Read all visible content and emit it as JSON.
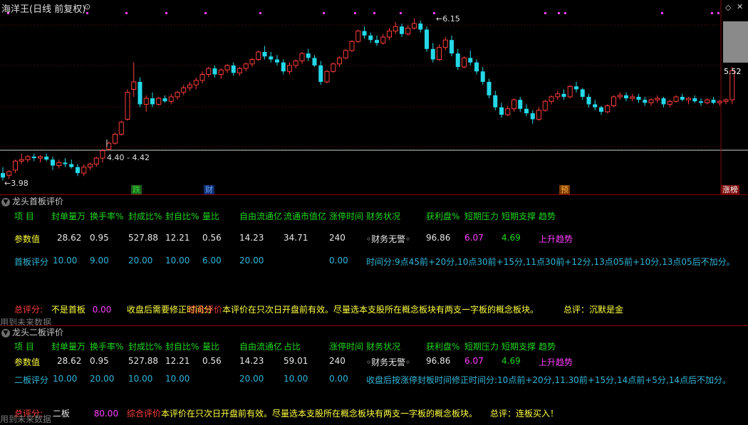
{
  "chart": {
    "title": "海洋王(日线 前复权)",
    "high_label": "6.15",
    "low_label": "3.98",
    "ref_label": "4.40 - 4.42",
    "price_tag": "5.52",
    "markers": [
      {
        "label": "跌",
        "bg": "#1f5f1f",
        "color": "#2fe02f"
      },
      {
        "label": "财",
        "bg": "#0f2f6f",
        "color": "#6fa8ff"
      },
      {
        "label": "预",
        "bg": "#7a3a00",
        "color": "#ffb040"
      },
      {
        "label": "涨榜",
        "bg": "#7a0a0a",
        "color": "#ffffff"
      }
    ],
    "candles": [
      [
        4.08,
        4.16,
        3.98,
        4.02
      ],
      [
        4.05,
        4.12,
        4.0,
        4.1
      ],
      [
        4.12,
        4.26,
        4.08,
        4.24
      ],
      [
        4.24,
        4.34,
        4.2,
        4.26
      ],
      [
        4.26,
        4.32,
        4.22,
        4.3
      ],
      [
        4.3,
        4.34,
        4.24,
        4.28
      ],
      [
        4.28,
        4.32,
        4.22,
        4.3
      ],
      [
        4.3,
        4.34,
        4.24,
        4.26
      ],
      [
        4.26,
        4.3,
        4.12,
        4.18
      ],
      [
        4.18,
        4.26,
        4.14,
        4.22
      ],
      [
        4.22,
        4.28,
        4.16,
        4.2
      ],
      [
        4.2,
        4.26,
        4.14,
        4.16
      ],
      [
        4.16,
        4.2,
        4.04,
        4.08
      ],
      [
        4.08,
        4.2,
        4.04,
        4.16
      ],
      [
        4.16,
        4.22,
        4.12,
        4.2
      ],
      [
        4.2,
        4.3,
        4.16,
        4.28
      ],
      [
        4.28,
        4.4,
        4.22,
        4.38
      ],
      [
        4.4,
        4.5,
        4.38,
        4.48
      ],
      [
        4.48,
        4.62,
        4.46,
        4.6
      ],
      [
        4.6,
        4.78,
        4.58,
        4.76
      ],
      [
        4.8,
        5.2,
        4.78,
        5.16
      ],
      [
        5.2,
        5.56,
        5.1,
        5.3
      ],
      [
        5.3,
        5.36,
        4.96,
        5.0
      ],
      [
        5.0,
        5.12,
        4.9,
        5.08
      ],
      [
        5.08,
        5.16,
        4.96,
        5.0
      ],
      [
        5.0,
        5.1,
        4.98,
        5.08
      ],
      [
        5.08,
        5.12,
        5.02,
        5.04
      ],
      [
        5.04,
        5.14,
        5.0,
        5.1
      ],
      [
        5.1,
        5.18,
        5.06,
        5.16
      ],
      [
        5.16,
        5.26,
        5.12,
        5.22
      ],
      [
        5.22,
        5.3,
        5.18,
        5.26
      ],
      [
        5.26,
        5.36,
        5.2,
        5.32
      ],
      [
        5.32,
        5.44,
        5.28,
        5.4
      ],
      [
        5.4,
        5.5,
        5.36,
        5.48
      ],
      [
        5.48,
        5.52,
        5.36,
        5.4
      ],
      [
        5.4,
        5.48,
        5.34,
        5.46
      ],
      [
        5.46,
        5.54,
        5.42,
        5.52
      ],
      [
        5.52,
        5.56,
        5.38,
        5.42
      ],
      [
        5.42,
        5.5,
        5.38,
        5.48
      ],
      [
        5.48,
        5.56,
        5.44,
        5.54
      ],
      [
        5.54,
        5.62,
        5.5,
        5.6
      ],
      [
        5.6,
        5.72,
        5.58,
        5.7
      ],
      [
        5.7,
        5.78,
        5.6,
        5.64
      ],
      [
        5.64,
        5.7,
        5.56,
        5.6
      ],
      [
        5.6,
        5.66,
        5.52,
        5.56
      ],
      [
        5.56,
        5.6,
        5.4,
        5.44
      ],
      [
        5.44,
        5.56,
        5.4,
        5.52
      ],
      [
        5.52,
        5.6,
        5.48,
        5.58
      ],
      [
        5.58,
        5.7,
        5.54,
        5.68
      ],
      [
        5.68,
        5.74,
        5.58,
        5.62
      ],
      [
        5.62,
        5.66,
        5.5,
        5.52
      ],
      [
        5.52,
        5.58,
        5.26,
        5.3
      ],
      [
        5.3,
        5.46,
        5.28,
        5.44
      ],
      [
        5.44,
        5.56,
        5.42,
        5.54
      ],
      [
        5.54,
        5.64,
        5.5,
        5.62
      ],
      [
        5.62,
        5.74,
        5.6,
        5.72
      ],
      [
        5.72,
        5.86,
        5.7,
        5.84
      ],
      [
        5.84,
        6.0,
        5.82,
        5.98
      ],
      [
        5.98,
        6.04,
        5.88,
        5.92
      ],
      [
        5.92,
        5.96,
        5.82,
        5.86
      ],
      [
        5.86,
        5.92,
        5.78,
        5.82
      ],
      [
        5.82,
        5.94,
        5.8,
        5.9
      ],
      [
        5.9,
        6.02,
        5.86,
        5.98
      ],
      [
        5.98,
        6.1,
        5.94,
        6.04
      ],
      [
        6.04,
        6.08,
        5.9,
        5.94
      ],
      [
        5.94,
        6.06,
        5.92,
        6.02
      ],
      [
        6.02,
        6.15,
        6.0,
        6.08
      ],
      [
        6.08,
        6.12,
        5.96,
        6.0
      ],
      [
        6.0,
        6.04,
        5.7,
        5.74
      ],
      [
        5.74,
        5.82,
        5.56,
        5.6
      ],
      [
        5.6,
        5.8,
        5.58,
        5.76
      ],
      [
        5.76,
        5.9,
        5.72,
        5.86
      ],
      [
        5.86,
        5.92,
        5.64,
        5.68
      ],
      [
        5.68,
        5.74,
        5.46,
        5.5
      ],
      [
        5.5,
        5.64,
        5.48,
        5.62
      ],
      [
        5.62,
        5.72,
        5.52,
        5.56
      ],
      [
        5.56,
        5.6,
        5.4,
        5.44
      ],
      [
        5.44,
        5.5,
        5.26,
        5.3
      ],
      [
        5.3,
        5.34,
        5.08,
        5.12
      ],
      [
        5.12,
        5.18,
        4.92,
        4.96
      ],
      [
        4.96,
        5.02,
        4.82,
        4.86
      ],
      [
        4.86,
        4.98,
        4.84,
        4.94
      ],
      [
        4.94,
        5.08,
        4.9,
        5.06
      ],
      [
        5.06,
        5.1,
        4.9,
        4.94
      ],
      [
        4.94,
        5.0,
        4.84,
        4.88
      ],
      [
        4.88,
        4.92,
        4.74,
        4.8
      ],
      [
        4.8,
        4.96,
        4.78,
        4.92
      ],
      [
        4.92,
        5.06,
        4.9,
        5.04
      ],
      [
        5.04,
        5.12,
        5.0,
        5.1
      ],
      [
        5.1,
        5.18,
        5.06,
        5.14
      ],
      [
        5.14,
        5.2,
        5.06,
        5.1
      ],
      [
        5.1,
        5.26,
        5.08,
        5.24
      ],
      [
        5.24,
        5.3,
        5.16,
        5.2
      ],
      [
        5.2,
        5.22,
        5.06,
        5.1
      ],
      [
        5.1,
        5.14,
        4.96,
        5.0
      ],
      [
        5.0,
        5.06,
        4.92,
        4.96
      ],
      [
        4.96,
        4.98,
        4.86,
        4.9
      ],
      [
        4.9,
        5.0,
        4.88,
        4.98
      ],
      [
        4.98,
        5.12,
        4.96,
        5.1
      ],
      [
        5.1,
        5.16,
        5.06,
        5.12
      ],
      [
        5.12,
        5.16,
        5.04,
        5.08
      ],
      [
        5.08,
        5.14,
        5.04,
        5.1
      ],
      [
        5.1,
        5.14,
        5.02,
        5.06
      ],
      [
        5.06,
        5.1,
        4.98,
        5.02
      ],
      [
        5.02,
        5.08,
        4.98,
        5.06
      ],
      [
        5.06,
        5.12,
        5.02,
        5.08
      ],
      [
        5.08,
        5.1,
        4.96,
        5.0
      ],
      [
        5.0,
        5.06,
        4.96,
        5.04
      ],
      [
        5.04,
        5.12,
        5.02,
        5.1
      ],
      [
        5.1,
        5.14,
        5.04,
        5.06
      ],
      [
        5.06,
        5.1,
        5.0,
        5.08
      ],
      [
        5.08,
        5.12,
        5.02,
        5.04
      ],
      [
        5.04,
        5.08,
        4.98,
        5.02
      ],
      [
        5.02,
        5.08,
        5.0,
        5.06
      ],
      [
        5.06,
        5.1,
        5.0,
        5.02
      ],
      [
        5.02,
        5.06,
        4.98,
        5.04
      ],
      [
        5.04,
        5.08,
        5.0,
        5.06
      ],
      [
        5.06,
        5.5,
        5.0,
        5.45
      ]
    ]
  },
  "panel1": {
    "title": "龙头首板评价",
    "headers": [
      "项 目",
      "封单量万",
      "换手率%",
      "封成比%",
      "封自比%",
      "量比",
      "自由流通亿",
      "流通市值亿",
      "涨停时间",
      "财务状况",
      "获利盘%",
      "短期压力",
      "短期支撑",
      "趋势"
    ],
    "param_label": "参数值",
    "params": [
      "28.62",
      "0.95",
      "527.88",
      "12.21",
      "0.56",
      "14.23",
      "34.71",
      "240",
      "◦财务无警◦",
      "96.86",
      "6.07",
      "4.69",
      "上升趋势"
    ],
    "score_label": "首板评分",
    "scores": [
      "10.00",
      "9.00",
      "20.00",
      "10.00",
      "6.00",
      "20.00",
      "0.00"
    ],
    "time_note": "时间分:9点45前+20分,10点30前+15分,11点30前+12分,13点05前+10分,13点05后不加分。",
    "total_label": "总评分:",
    "total_type": "不是首板",
    "total_score": "0.00",
    "note_a": "收盘后需要修正时间分",
    "note_red": "综合评价",
    "note_b": "本评价在只次日开盘前有效。尽量选本支股所在概念板块有两支一字板的概念板块。",
    "verdict": "总评：沉默是金",
    "future": "用到未来数据"
  },
  "panel2": {
    "title": "龙头二板评价",
    "headers": [
      "项 目",
      "封单量万",
      "换手率%",
      "封成比%",
      "封自比%",
      "量比",
      "自由流通亿",
      "占比",
      "涨停时间",
      "财务状况",
      "获利盘%",
      "短期压力",
      "短期支撑",
      "趋势"
    ],
    "param_label": "参数值",
    "params": [
      "28.62",
      "0.95",
      "527.88",
      "12.21",
      "0.56",
      "14.23",
      "59.01",
      "240",
      "◦财务无警◦",
      "96.86",
      "6.07",
      "4.69",
      "上升趋势"
    ],
    "score_label": "二板评分",
    "scores": [
      "10.00",
      "20.00",
      "10.00",
      "10.00",
      "20.00",
      "10.00",
      "0.00"
    ],
    "time_note": "收盘后按涨停封板时间修正时间分:10点前+20分,11.30前+15分,14点前+5分,14点后不加分。",
    "total_label": "总评分:",
    "total_type": "二板",
    "total_score": "80.00",
    "note_red": "综合评价",
    "note_b": "本评价在只次日开盘前有效。尽量选本支股所在概念板块有两支一字板的概念板块。",
    "verdict": "总评：连板买入！",
    "future": "用到未来数据"
  }
}
